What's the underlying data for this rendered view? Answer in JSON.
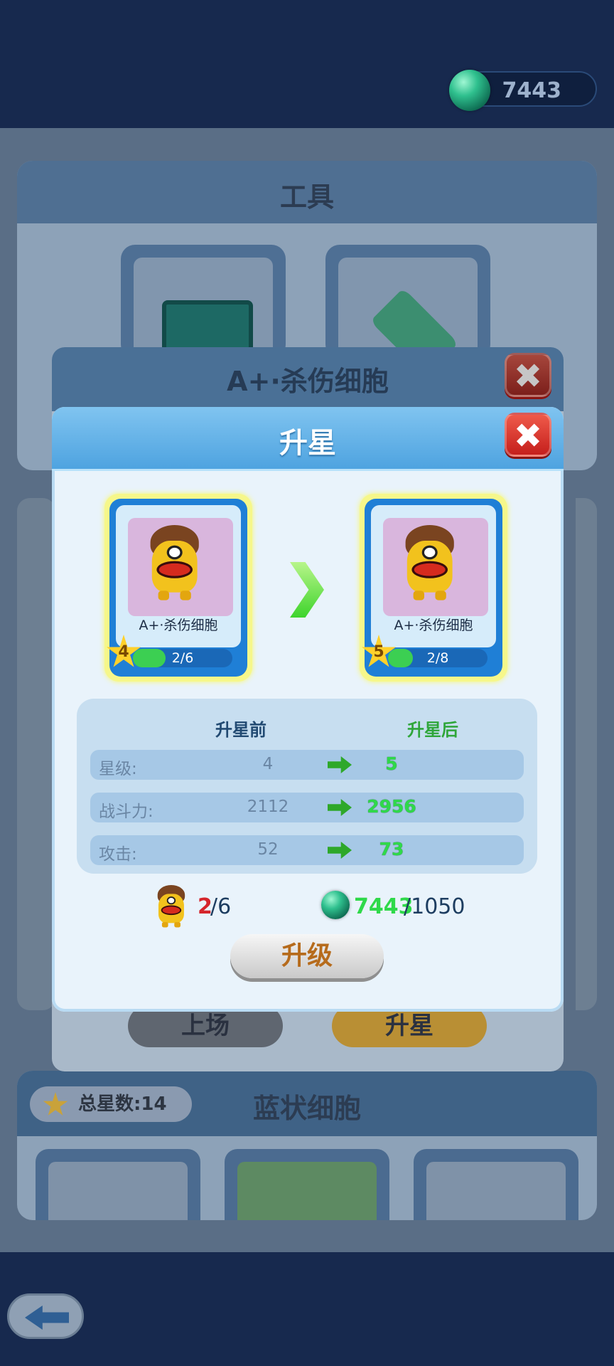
{
  "header": {
    "gems": "7443"
  },
  "background": {
    "tools_title": "工具",
    "cells_title": "蓝状细胞",
    "star_total": "总星数:14",
    "under_dialog_title": "A+·杀伤细胞",
    "deploy_label": "上场",
    "star_up_label": "升星"
  },
  "dialog": {
    "title": "升星",
    "close_glyph": "✖",
    "card_before": {
      "name": "A+·杀伤细胞",
      "level": "4",
      "progress_text": "2/6",
      "progress": 0.33
    },
    "card_after": {
      "name": "A+·杀伤细胞",
      "level": "5",
      "progress_text": "2/8",
      "progress": 0.25
    },
    "stats": {
      "before_header": "升星前",
      "after_header": "升星后",
      "rows": [
        {
          "label": "星级:",
          "before": "4",
          "after": "5"
        },
        {
          "label": "战斗力:",
          "before": "2112",
          "after": "2956"
        },
        {
          "label": "攻击:",
          "before": "52",
          "after": "73"
        }
      ]
    },
    "cost": {
      "shard_have": "2",
      "shard_need": "/6",
      "gem_have": "7443",
      "gem_need": "/1050"
    },
    "upgrade_label": "升级"
  },
  "colors": {
    "accent_green": "#2fd94a",
    "header_blue": "#4ea3e0",
    "close_red": "#c51f1c"
  },
  "icons": [
    "gem-icon",
    "close-icon",
    "star-icon",
    "chevron-right-icon",
    "arrow-right-icon",
    "back-arrow-icon"
  ]
}
